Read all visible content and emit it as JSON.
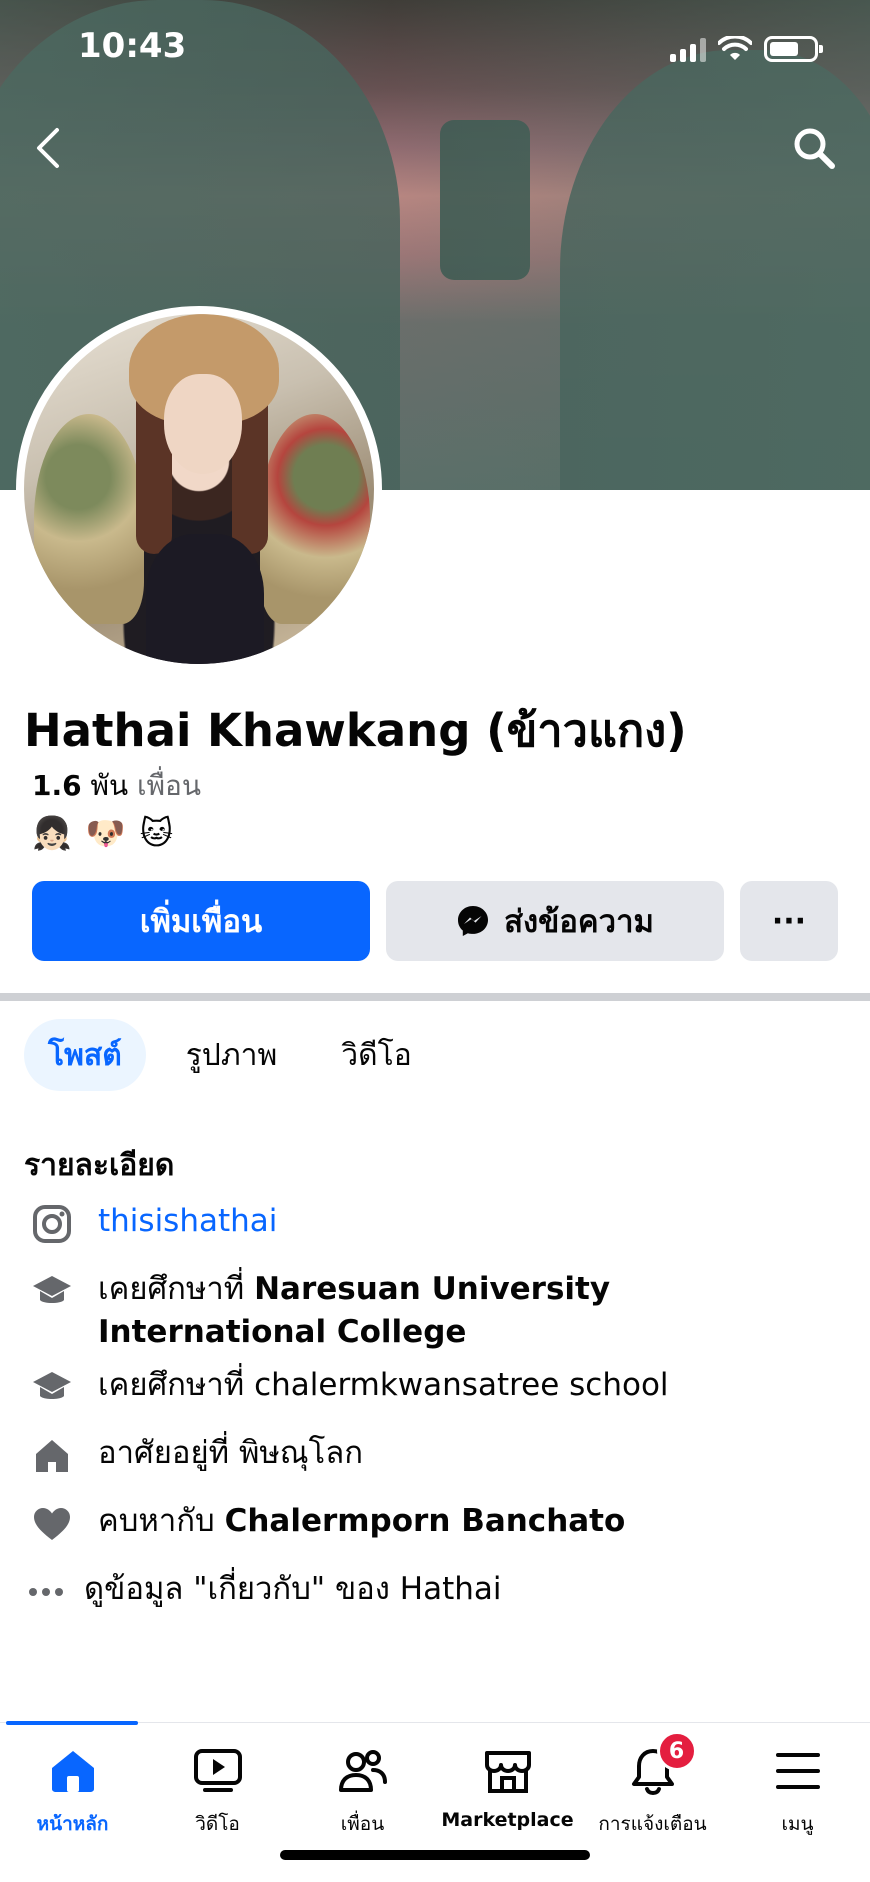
{
  "status_bar": {
    "time": "10:43"
  },
  "profile": {
    "name": "Hathai Khawkang (ข้าวแกง)",
    "friends_count": "1.6",
    "friends_unit": "พัน",
    "friends_label": "เพื่อน",
    "emojis": [
      "👧🏻",
      "🐶",
      "🐱"
    ]
  },
  "actions": {
    "add_friend": "เพิ่มเพื่อน",
    "message": "ส่งข้อความ",
    "more": "···"
  },
  "tabs": [
    {
      "label": "โพสต์",
      "active": true
    },
    {
      "label": "รูปภาพ",
      "active": false
    },
    {
      "label": "วิดีโอ",
      "active": false
    }
  ],
  "details": {
    "title": "รายละเอียด",
    "instagram": "thisishathai",
    "edu1_prefix": "เคยศึกษาที่",
    "edu1_school": "Naresuan University International College",
    "edu2_text": "เคยศึกษาที่ chalermkwansatree school",
    "lives_text": "อาศัยอยู่ที่ พิษณุโลก",
    "relationship_prefix": "คบหากับ",
    "relationship_name": "Chalermporn Banchato",
    "see_about": "ดูข้อมูล \"เกี่ยวกับ\" ของ Hathai"
  },
  "bottom_nav": {
    "home": "หน้าหลัก",
    "video": "วิดีโอ",
    "friends": "เพื่อน",
    "marketplace": "Marketplace",
    "notifications": "การแจ้งเตือน",
    "notifications_badge": "6",
    "menu": "เมนู"
  },
  "colors": {
    "accent": "#0866ff",
    "button_gray": "#e4e6eb",
    "badge_red": "#e41e3f",
    "secondary_text": "#65676b"
  }
}
